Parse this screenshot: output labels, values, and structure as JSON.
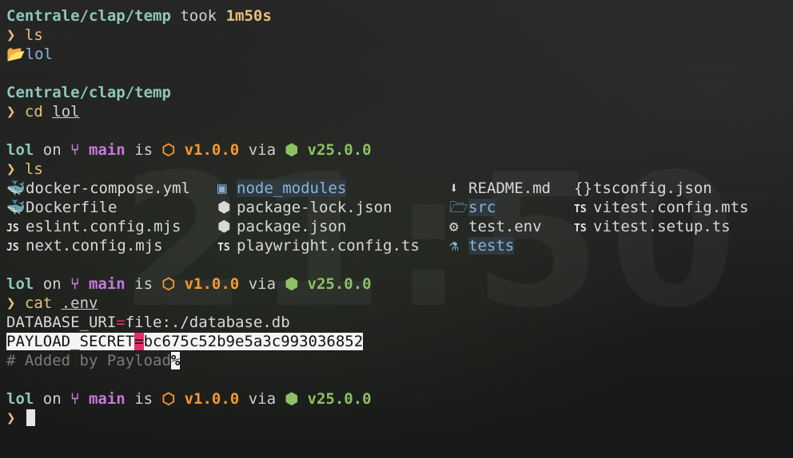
{
  "watermark": "21:50",
  "block1": {
    "path": "Centrale/clap/temp",
    "took_label": "took",
    "duration": "1m50s",
    "cmd": "ls",
    "entry": "lol"
  },
  "block2": {
    "path": "Centrale/clap/temp",
    "cmd": "cd",
    "arg": "lol"
  },
  "status": {
    "dir": "lol",
    "on": "on",
    "branch": "main",
    "is": "is",
    "version": "v1.0.0",
    "via": "via",
    "node_version": "v25.0.0"
  },
  "prompt_char": "❯",
  "block3": {
    "cmd": "ls",
    "files": [
      {
        "icon": "docker-icon",
        "glyph": "🐳",
        "name": "docker-compose.yml"
      },
      {
        "icon": "folder-node-icon",
        "glyph": "▣",
        "name": "node_modules",
        "highlight": true
      },
      {
        "icon": "download-icon",
        "glyph": "⬇",
        "name": "README.md"
      },
      {
        "icon": "braces-icon",
        "glyph": "{}",
        "name": "tsconfig.json"
      },
      {
        "icon": "docker-icon",
        "glyph": "🐳",
        "name": "Dockerfile"
      },
      {
        "icon": "hexagon-icon",
        "glyph": "⬢",
        "name": "package-lock.json"
      },
      {
        "icon": "folder-search-icon",
        "glyph": "🗁",
        "name": "src",
        "highlight": true
      },
      {
        "icon": "ts-icon",
        "glyph": "TS",
        "name": "vitest.config.mts"
      },
      {
        "icon": "js-icon",
        "glyph": "JS",
        "name": "eslint.config.mjs"
      },
      {
        "icon": "hexagon-icon",
        "glyph": "⬢",
        "name": "package.json"
      },
      {
        "icon": "sliders-icon",
        "glyph": "⚙",
        "name": "test.env"
      },
      {
        "icon": "ts-icon",
        "glyph": "TS",
        "name": "vitest.setup.ts"
      },
      {
        "icon": "js-icon",
        "glyph": "JS",
        "name": "next.config.mjs"
      },
      {
        "icon": "ts-icon",
        "glyph": "TS",
        "name": "playwright.config.ts"
      },
      {
        "icon": "flask-icon",
        "glyph": "⚗",
        "name": "tests",
        "highlight": true
      },
      {
        "icon": "",
        "glyph": "",
        "name": ""
      }
    ]
  },
  "block4": {
    "cmd": "cat",
    "arg": ".env",
    "line1_key": "DATABASE_URI",
    "eq": "=",
    "line1_val": "file:./database.db",
    "line2_key": "PAYLOAD_SECRET",
    "line2_val": "bc675c52b9e5a3c993036852",
    "comment": "# Added by Payload",
    "percent": "%"
  },
  "colors": {
    "path": "#8fc7bb",
    "prompt": "#e5c07b",
    "git": "#c678dd",
    "package": "#f59a2f",
    "node": "#8cc265",
    "separator": "#e0306a"
  }
}
